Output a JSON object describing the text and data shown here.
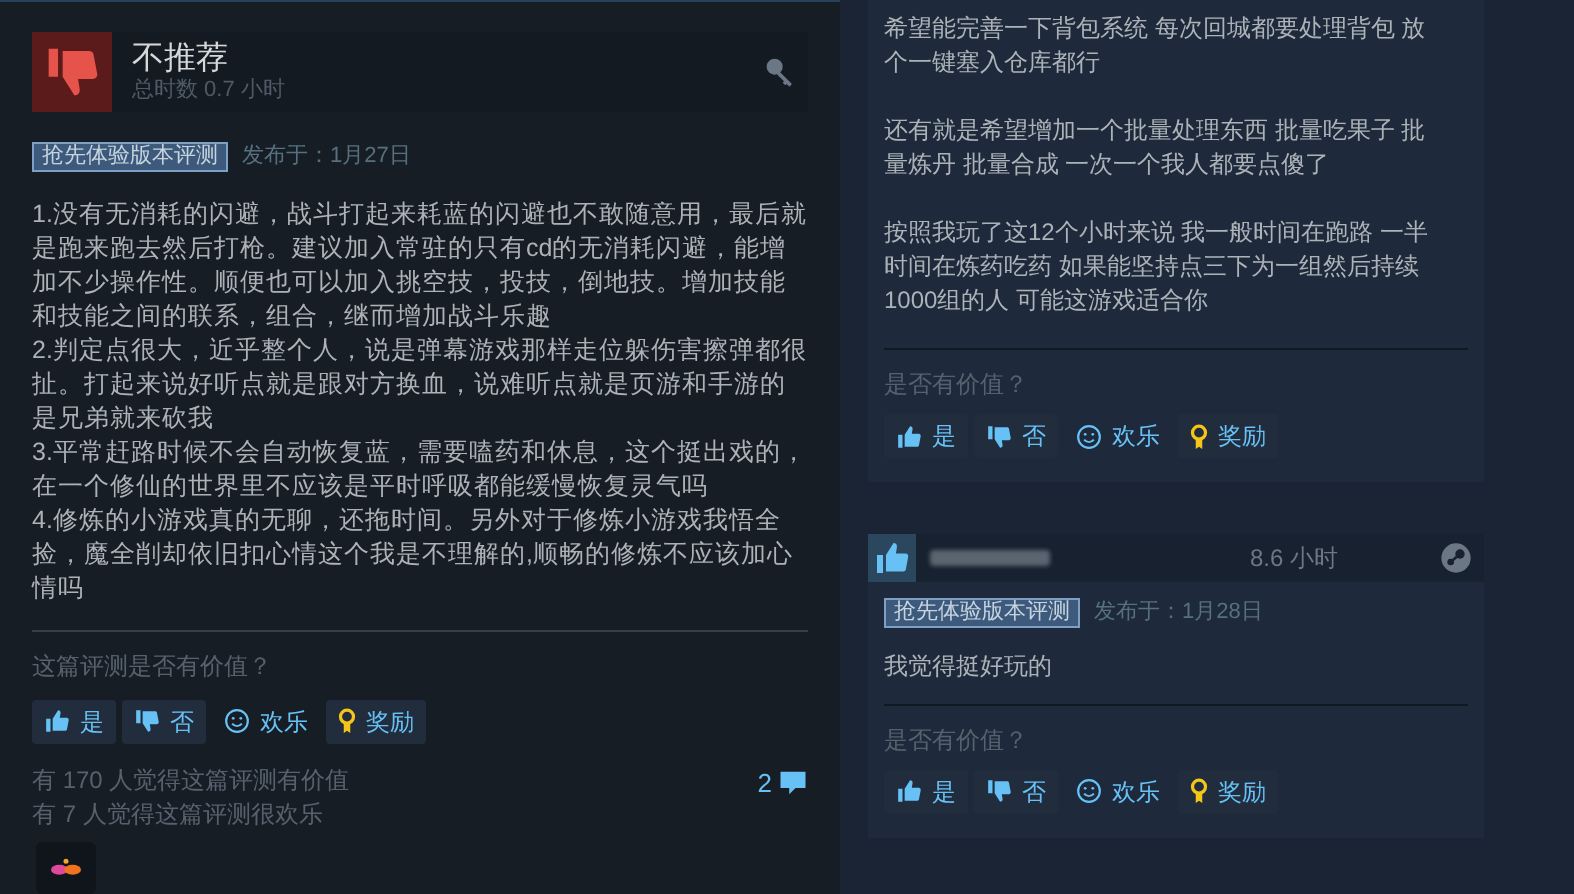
{
  "left_review": {
    "verdict": "不推荐",
    "recommended": false,
    "playtime": "总时数 0.7 小时",
    "tag": "抢先体验版本评测",
    "posted": "发布于：1月27日",
    "paragraphs": [
      "1.没有无消耗的闪避，战斗打起来耗蓝的闪避也不敢随意用，最后就是跑来跑去然后打枪。建议加入常驻的只有cd的无消耗闪避，能增加不少操作性。顺便也可以加入挑空技，投技，倒地技。增加技能和技能之间的联系，组合，继而增加战斗乐趣",
      "2.判定点很大，近乎整个人，说是弹幕游戏那样走位躲伤害擦弹都很扯。打起来说好听点就是跟对方换血，说难听点就是页游和手游的是兄弟就来砍我",
      "3.平常赶路时候不会自动恢复蓝，需要嗑药和休息，这个挺出戏的，在一个修仙的世界里不应该是平时呼吸都能缓慢恢复灵气吗",
      "4.修炼的小游戏真的无聊，还拖时间。另外对于修炼小游戏我悟全捡，魔全削却依旧扣心情这个我是不理解的,顺畅的修炼不应该加心情吗"
    ],
    "helpful_prompt": "这篇评测是否有价值？",
    "buttons": [
      {
        "kind": "yes",
        "label": "是"
      },
      {
        "kind": "no",
        "label": "否"
      },
      {
        "kind": "funny",
        "label": "欢乐"
      },
      {
        "kind": "award",
        "label": "奖励"
      }
    ],
    "stats": [
      "有 170 人觉得这篇评测有价值",
      "有 7 人觉得这篇评测很欢乐"
    ],
    "comments": "2"
  },
  "right_reviews": [
    {
      "paragraphs": [
        "希望能完善一下背包系统 每次回城都要处理背包 放个一键塞入仓库都行",
        "还有就是希望增加一个批量处理东西 批量吃果子 批量炼丹 批量合成 一次一个我人都要点傻了",
        "按照我玩了这12个小时来说 我一般时间在跑路 一半时间在炼药吃药 如果能坚持点三下为一组然后持续1000组的人 可能这游戏适合你"
      ],
      "helpful_prompt": "是否有价值？",
      "buttons": [
        {
          "kind": "yes",
          "label": "是"
        },
        {
          "kind": "no",
          "label": "否"
        },
        {
          "kind": "funny",
          "label": "欢乐"
        },
        {
          "kind": "award",
          "label": "奖励"
        }
      ]
    },
    {
      "header": {
        "recommended": true,
        "playtime": "8.6 小时"
      },
      "tag": "抢先体验版本评测",
      "posted": "发布于：1月28日",
      "paragraphs": [
        "我觉得挺好玩的"
      ],
      "helpful_prompt": "是否有价值？",
      "buttons": [
        {
          "kind": "yes",
          "label": "是"
        },
        {
          "kind": "no",
          "label": "否"
        },
        {
          "kind": "funny",
          "label": "欢乐"
        },
        {
          "kind": "award",
          "label": "奖励"
        }
      ]
    }
  ]
}
